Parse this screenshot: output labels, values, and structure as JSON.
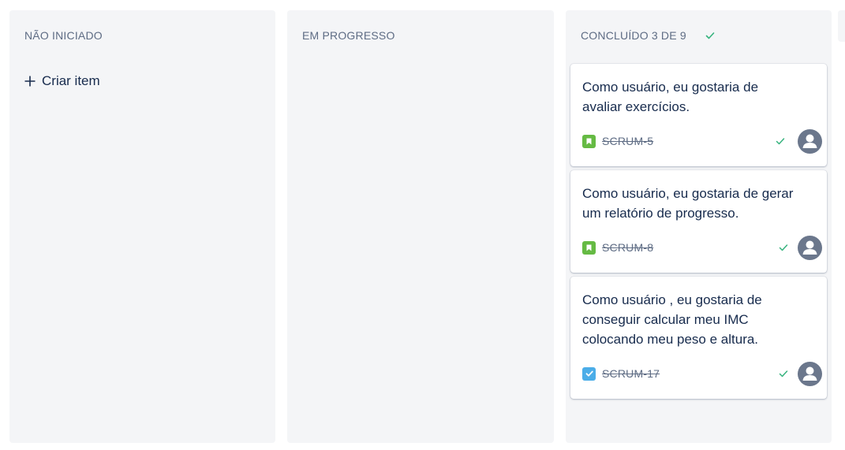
{
  "columns": [
    {
      "title": "NÃO INICIADO",
      "create_label": "Criar item"
    },
    {
      "title": "EM PROGRESSO"
    },
    {
      "title": "CONCLUÍDO",
      "count": "3 DE 9",
      "status_icon": "check-icon"
    }
  ],
  "cards": [
    {
      "title": "Como usuário, eu gostaria de avaliar exercícios.",
      "key": "SCRUM-5",
      "type_icon": "story-bookmark-icon",
      "status_icon": "check-icon",
      "assignee_icon": "default-avatar-icon"
    },
    {
      "title": "Como usuário, eu gostaria de gerar um relatório de progresso.",
      "key": "SCRUM-8",
      "type_icon": "story-bookmark-icon",
      "status_icon": "check-icon",
      "assignee_icon": "default-avatar-icon"
    },
    {
      "title": "Como usuário , eu gostaria de conseguir calcular meu IMC colocando meu peso e altura.",
      "key": "SCRUM-17",
      "type_icon": "task-checkbox-icon",
      "status_icon": "check-icon",
      "assignee_icon": "default-avatar-icon"
    }
  ],
  "colors": {
    "column_bg": "#f4f5f7",
    "story": "#65ba43",
    "task": "#4bade8",
    "done_check": "#36b37e",
    "avatar": "#6b778c"
  }
}
